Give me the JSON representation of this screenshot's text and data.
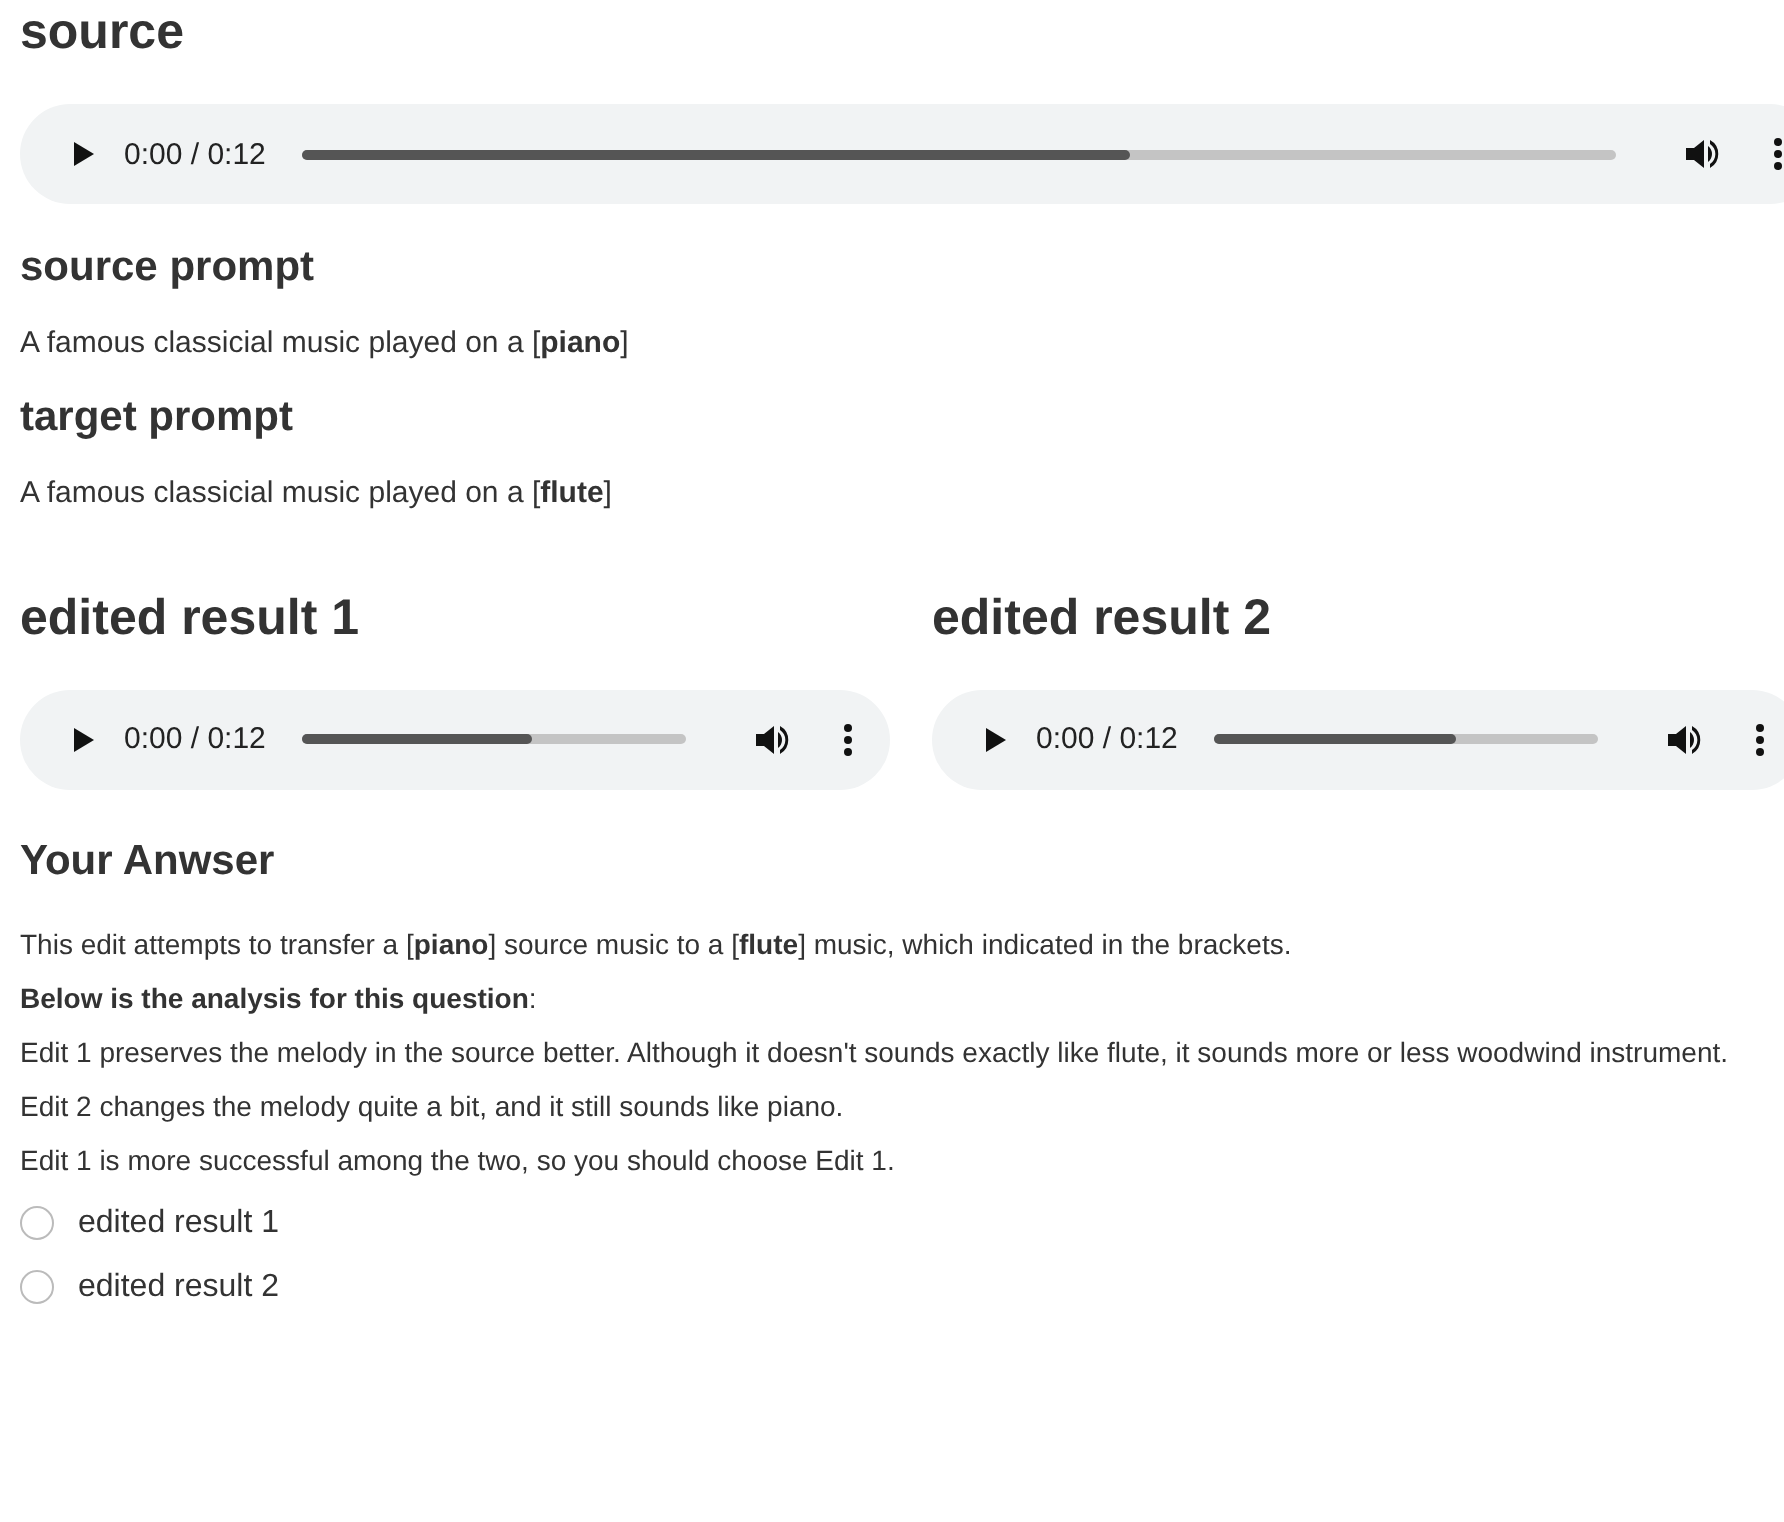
{
  "source": {
    "title": "source",
    "player": {
      "time": "0:00 / 0:12",
      "level": 0.63
    }
  },
  "source_prompt": {
    "title": "source prompt",
    "text": "A famous classicial music played on a [**piano**]"
  },
  "target_prompt": {
    "title": "target prompt",
    "text": "A famous classicial music played on a [**flute**]"
  },
  "results": [
    {
      "title": "edited result 1",
      "player": {
        "time": "0:00 / 0:12",
        "level": 0.6
      }
    },
    {
      "title": "edited result 2",
      "player": {
        "time": "0:00 / 0:12",
        "level": 0.63
      }
    }
  ],
  "answer": {
    "title": "Your Anwser",
    "lines": [
      "This edit attempts to transfer a [**piano**] source music to a [**flute**] music, which indicated in the brackets.",
      "**Below is the analysis for this question**:",
      "Edit 1 preserves the melody in the source better. Although it doesn't sounds exactly like flute, it sounds more or less woodwind instrument.",
      "Edit 2 changes the melody quite a bit, and it still sounds like piano.",
      "Edit 1 is more successful among the two, so you should choose Edit 1."
    ],
    "options": [
      {
        "label": "edited result 1",
        "selected": false
      },
      {
        "label": "edited result 2",
        "selected": false
      }
    ]
  }
}
